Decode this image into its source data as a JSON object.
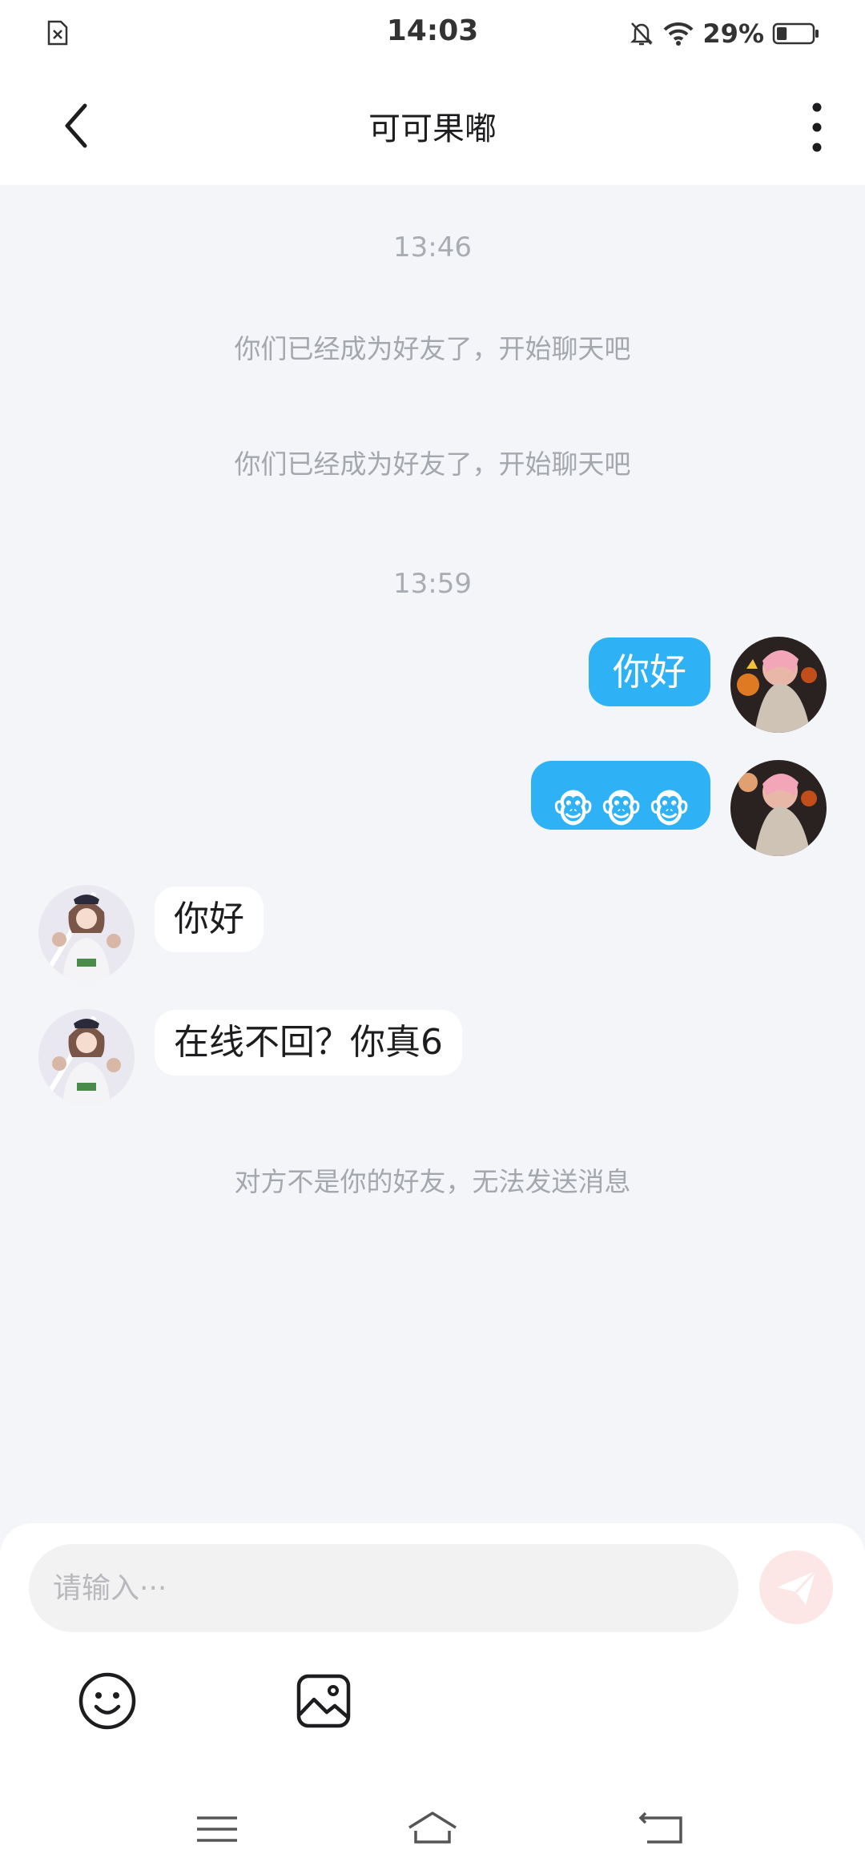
{
  "status_bar": {
    "time": "14:03",
    "battery_percent": "29%",
    "battery_level": 0.29,
    "icons": [
      "sim-error-icon",
      "mute-icon",
      "wifi-icon",
      "battery-icon"
    ]
  },
  "header": {
    "title": "可可果嘟",
    "back_icon": "chevron-left-icon",
    "more_icon": "more-vertical-icon"
  },
  "messages": {
    "ts1": "13:46",
    "sys1": "你们已经成为好友了，开始聊天吧",
    "sys2": "你们已经成为好友了，开始聊天吧",
    "ts2": "13:59",
    "out1": "你好",
    "out2_emoji": [
      "🐵",
      "🐵",
      "🐵"
    ],
    "in1": "你好",
    "in2": "在线不回？你真6",
    "sys3": "对方不是你的好友，无法发送消息"
  },
  "composer": {
    "placeholder": "请输入···",
    "send_icon": "send-icon",
    "tools": [
      "emoji-icon",
      "image-icon"
    ]
  },
  "system_nav": [
    "menu-icon",
    "home-icon",
    "back-icon"
  ],
  "colors": {
    "accent_blue": "#2eb2f5",
    "chat_bg": "#f4f5f8",
    "send_disabled": "#fde6e6"
  }
}
